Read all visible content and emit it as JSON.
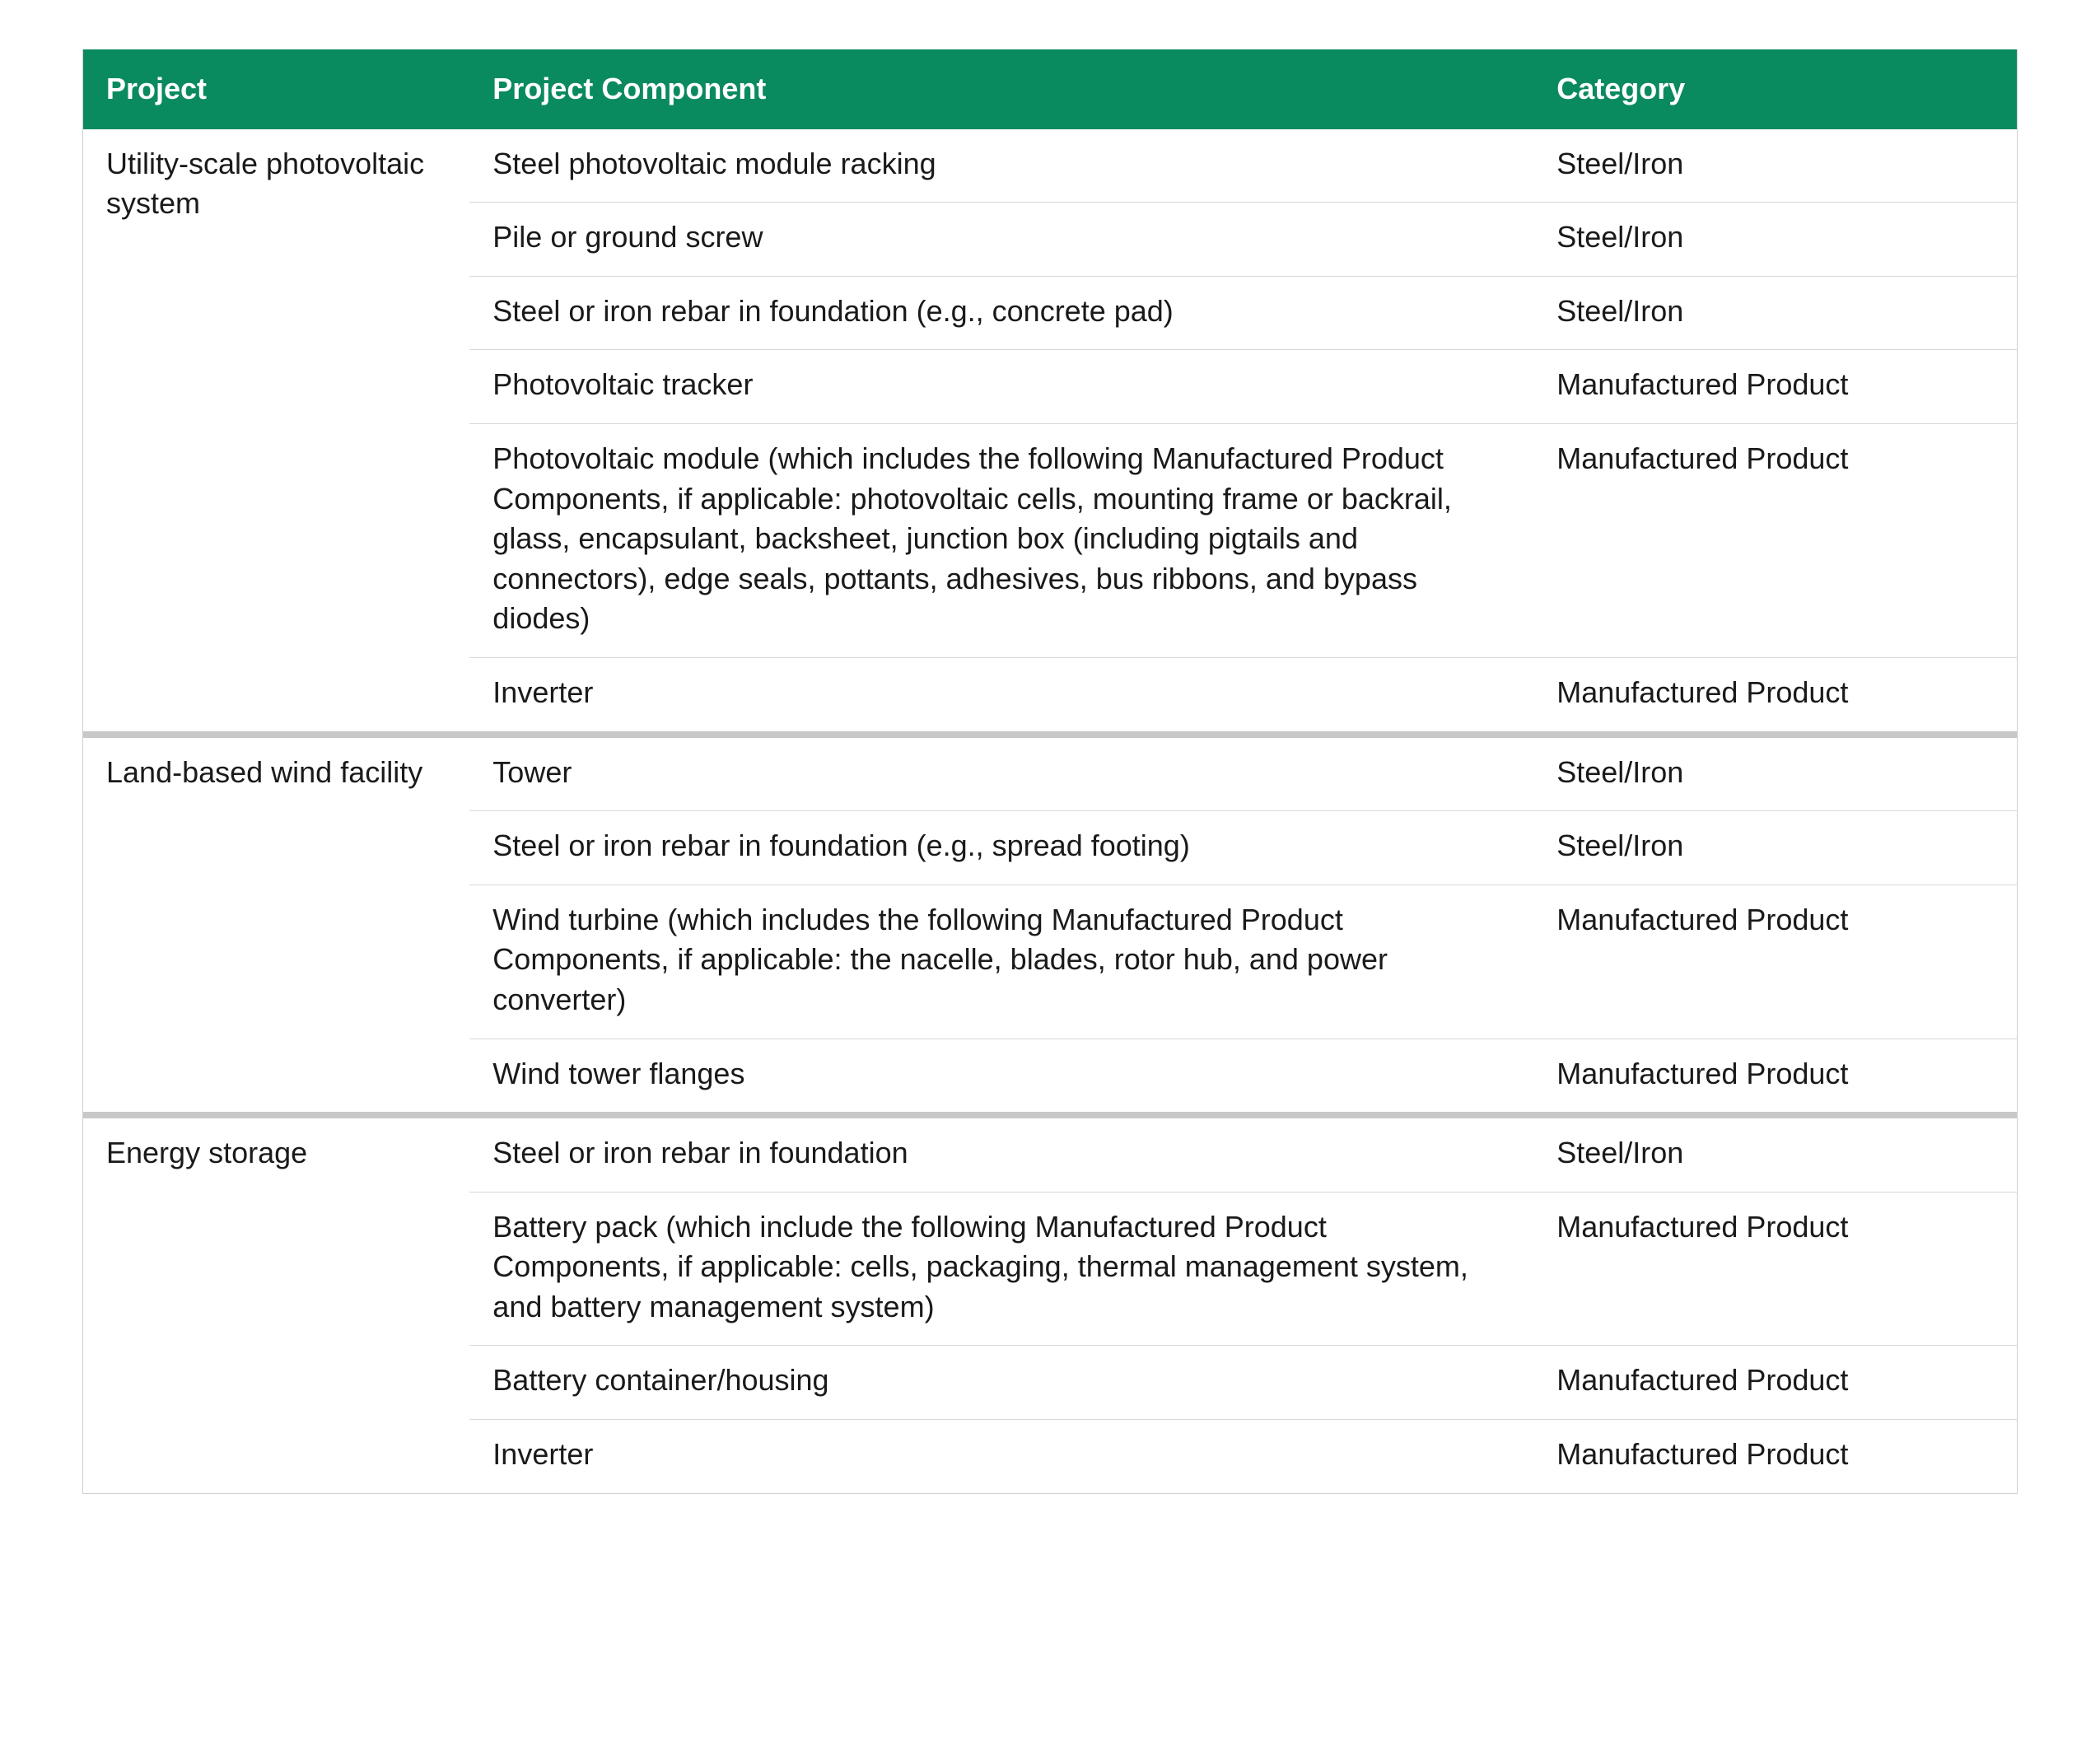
{
  "columns": {
    "project": "Project",
    "component": "Project Component",
    "category": "Category"
  },
  "groups": [
    {
      "name": "Utility-scale photovoltaic system",
      "rows": [
        {
          "component": "Steel photovoltaic module racking",
          "category": "Steel/Iron"
        },
        {
          "component": "Pile or ground screw",
          "category": "Steel/Iron"
        },
        {
          "component": "Steel or iron rebar in foundation (e.g., concrete pad)",
          "category": "Steel/Iron"
        },
        {
          "component": "Photovoltaic tracker",
          "category": "Manufactured Product"
        },
        {
          "component": "Photovoltaic module (which includes the following Manufactured Product Components, if applicable: photovoltaic cells, mounting frame or backrail, glass, encapsulant, backsheet, junction box (including pigtails and connectors), edge seals, pottants, adhesives, bus ribbons, and bypass diodes)",
          "category": "Manufactured Product"
        },
        {
          "component": "Inverter",
          "category": "Manufactured Product"
        }
      ]
    },
    {
      "name": "Land-based wind facility",
      "rows": [
        {
          "component": "Tower",
          "category": "Steel/Iron"
        },
        {
          "component": "Steel or iron rebar in foundation (e.g., spread footing)",
          "category": "Steel/Iron"
        },
        {
          "component": "Wind turbine (which includes the following Manufactured Product Components, if applicable: the nacelle, blades, rotor hub, and power converter)",
          "category": "Manufactured Product"
        },
        {
          "component": "Wind tower flanges",
          "category": "Manufactured Product"
        }
      ]
    },
    {
      "name": "Energy storage",
      "rows": [
        {
          "component": "Steel or iron rebar in foundation",
          "category": "Steel/Iron"
        },
        {
          "component": "Battery pack (which include the following Manufactured Product Components, if applicable: cells, packaging, thermal management system, and battery management system)",
          "category": "Manufactured Product"
        },
        {
          "component": "Battery container/housing",
          "category": "Manufactured Product"
        },
        {
          "component": "Inverter",
          "category": "Manufactured Product"
        }
      ]
    }
  ]
}
